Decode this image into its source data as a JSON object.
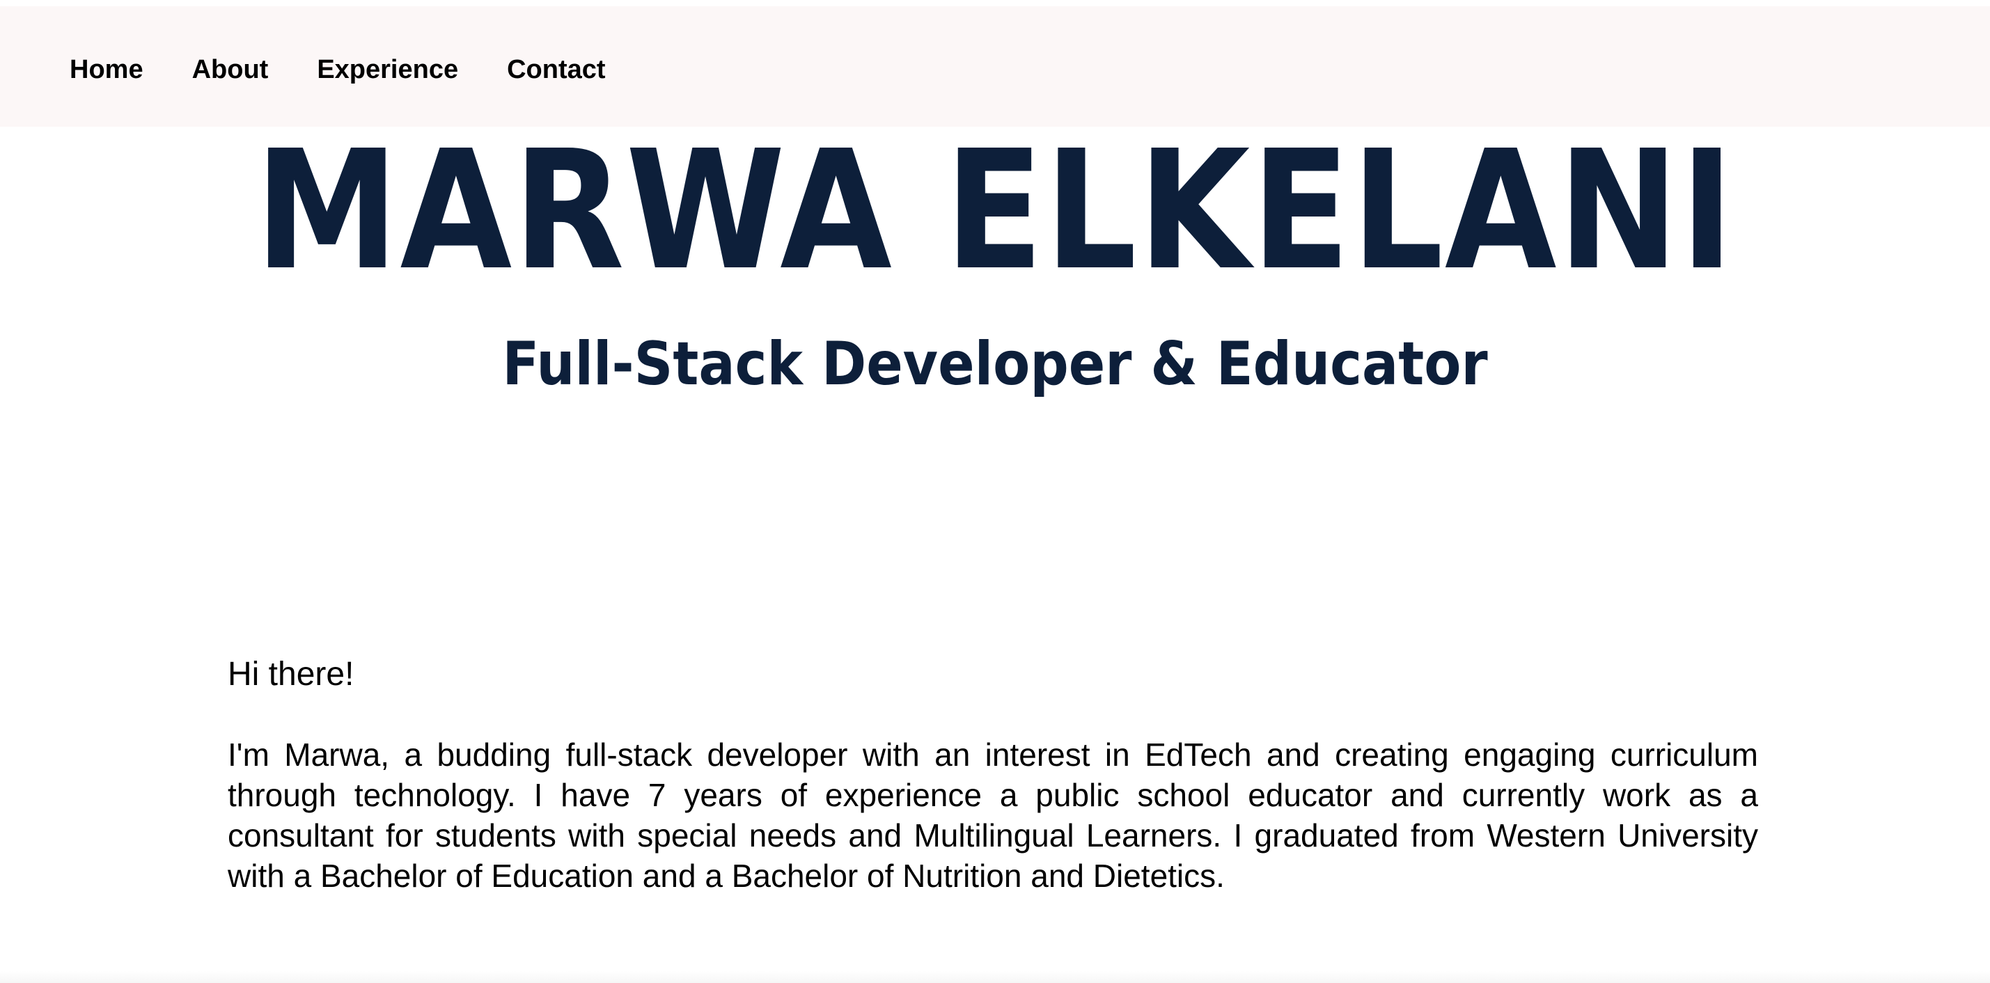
{
  "nav": {
    "items": [
      {
        "label": "Home"
      },
      {
        "label": "About"
      },
      {
        "label": "Experience"
      },
      {
        "label": "Contact"
      }
    ]
  },
  "hero": {
    "name": "MARWA ELKELANI",
    "subtitle": "Full-Stack Developer & Educator"
  },
  "intro": {
    "greeting": "Hi there!",
    "bio": "I'm Marwa, a budding full-stack developer with an interest in EdTech and creating engaging curriculum through technology. I have 7 years of experience a public school educator and currently work as a consultant for students with special needs and Multilingual Learners. I graduated from Western University with a Bachelor of Education and a Bachelor of Nutrition and Dietetics."
  },
  "colors": {
    "nav_background": "#fcf7f7",
    "heading": "#0d1f3a",
    "body_text": "#000000",
    "page_background": "#ffffff"
  }
}
